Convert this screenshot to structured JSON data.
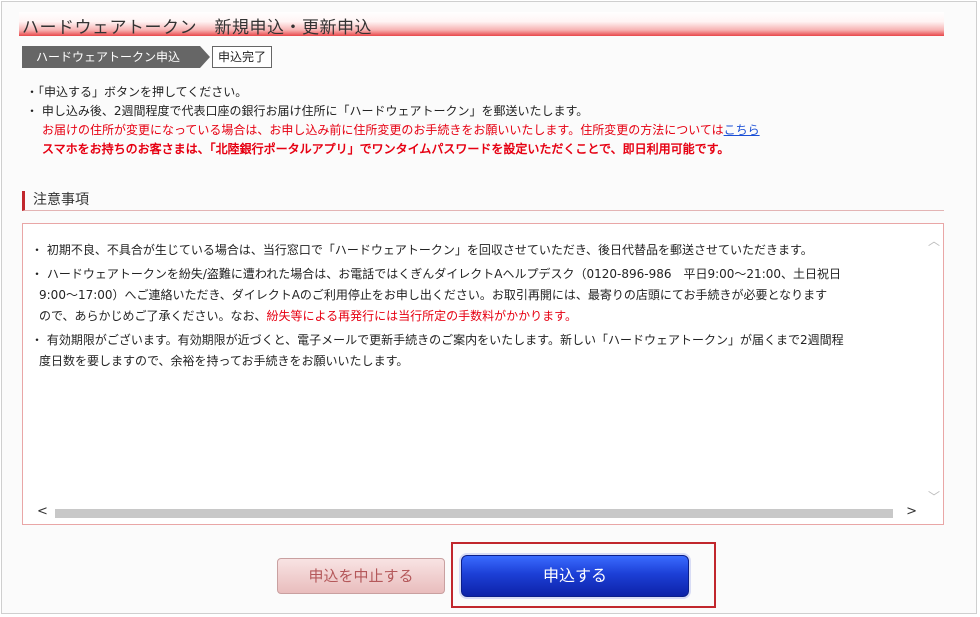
{
  "header": {
    "title": "ハードウェアトークン　新規申込・更新申込"
  },
  "breadcrumb": {
    "step1": "ハードウェアトークン申込",
    "step2": "申込完了"
  },
  "notes": {
    "line1": "・「申込する」ボタンを押してください。",
    "line2": "・ 申し込み後、2週間程度で代表口座の銀行お届け住所に「ハードウェアトークン」を郵送いたします。",
    "line3_red": "お届けの住所が変更になっている場合は、お申し込み前に住所変更のお手続きをお願いいたします。住所変更の方法については",
    "line3_link": "こちら",
    "line4_bold": "スマホをお持ちのお客さまは、「北陸銀行ポータルアプリ」でワンタイムパスワードを設定いただくことで、即日利用可能です。"
  },
  "caution": {
    "heading": "注意事項",
    "p1": "・ 初期不良、不具合が生じている場合は、当行窓口で「ハードウェアトークン」を回収させていただき、後日代替品を郵送させていただきます。",
    "p2a": "・ ハードウェアトークンを紛失/盗難に遭われた場合は、お電話ではくぎんダイレクトAヘルプデスク（0120-896-986　平日9:00～21:00、土日祝日",
    "p2b": "9:00～17:00）へご連絡いただき、ダイレクトAのご利用停止をお申し出ください。お取引再開には、最寄りの店頭にてお手続きが必要となります",
    "p2c": "ので、あらかじめご了承ください。なお、",
    "p2c_red": "紛失等による再発行には当行所定の手数料がかかります。",
    "p3a": "・ 有効期限がございます。有効期限が近づくと、電子メールで更新手続きのご案内をいたします。新しい「ハードウェアトークン」が届くまで2週間程",
    "p3b": "度日数を要しますので、余裕を持ってお手続きをお願いいたします。"
  },
  "buttons": {
    "cancel": "申込を中止する",
    "apply": "申込する"
  },
  "icons": {
    "scroll_up": "chevron-up-icon",
    "scroll_down": "chevron-down-icon",
    "scroll_left": "chevron-left-icon",
    "scroll_right": "chevron-right-icon"
  },
  "colors": {
    "accent_red": "#e60012",
    "link_blue": "#1a4fd6",
    "apply_blue": "#1c3fd6",
    "highlight_frame": "#c1272d"
  }
}
